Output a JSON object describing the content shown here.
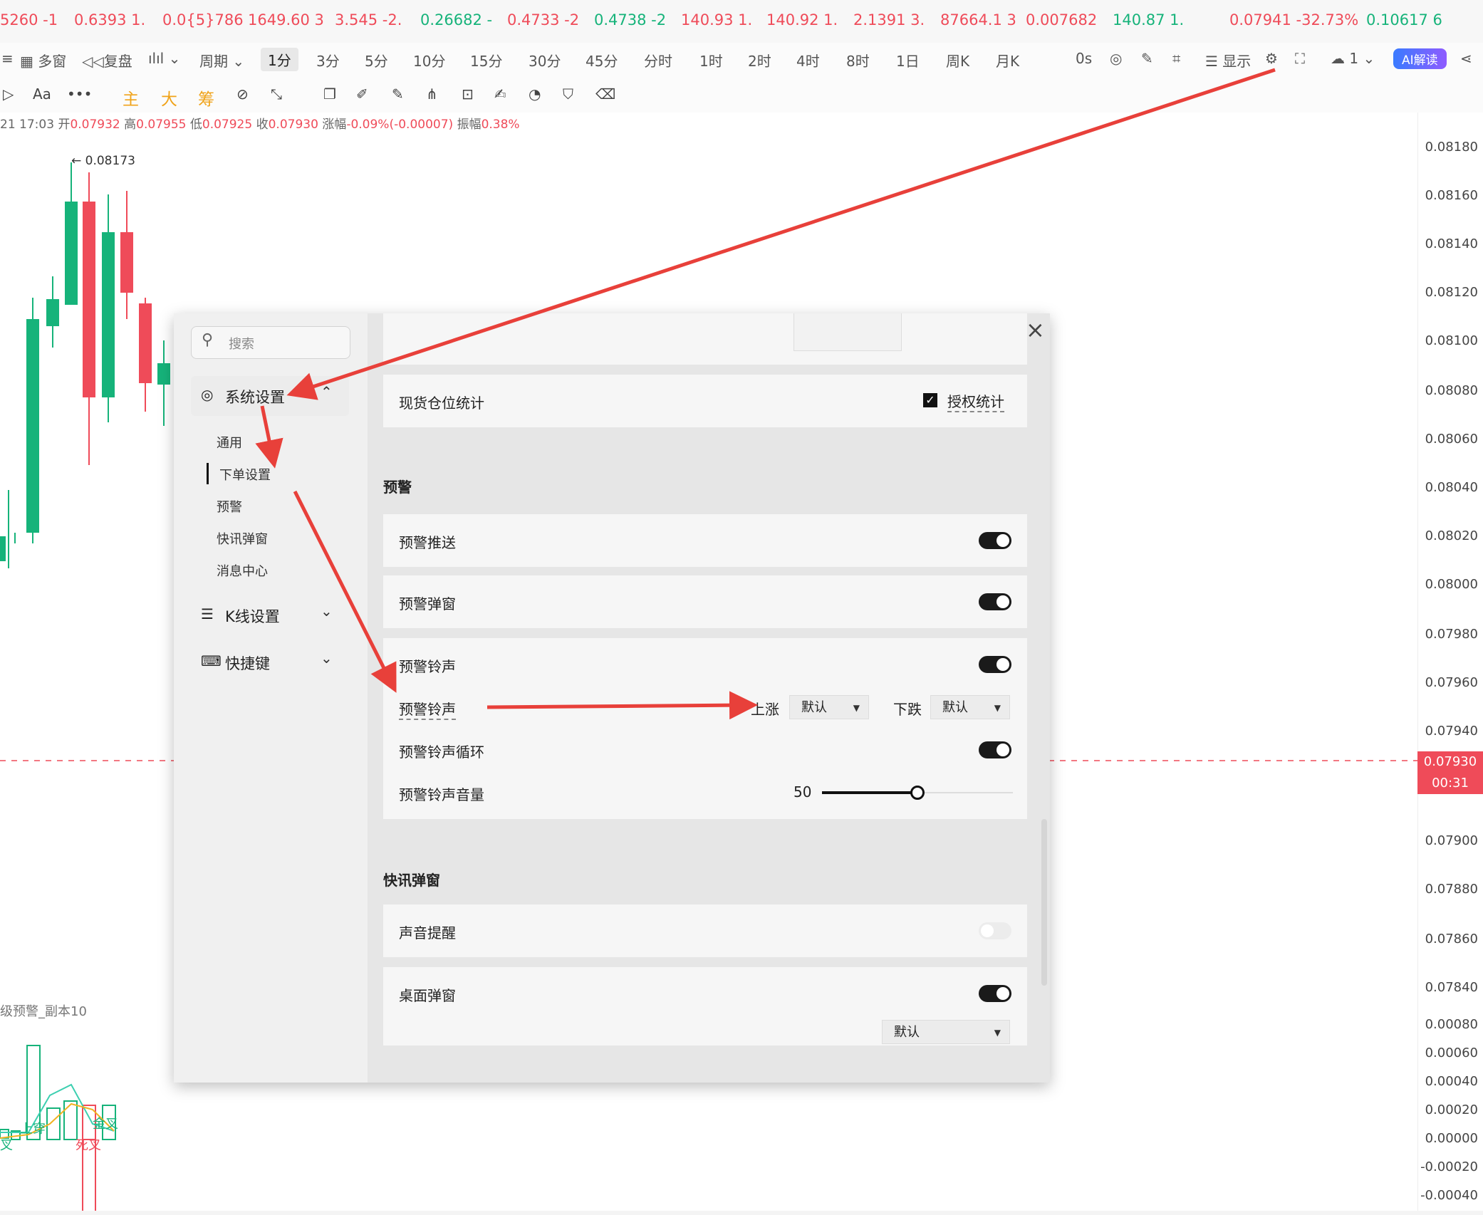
{
  "ticker": [
    {
      "text": "5260 -1",
      "cls": "dn"
    },
    {
      "text": "0.6393 1.",
      "cls": "dn"
    },
    {
      "text": "0.0{5}786",
      "cls": "dn"
    },
    {
      "text": "1649.60 3",
      "cls": "dn"
    },
    {
      "text": "3.545 -2.",
      "cls": "dn"
    },
    {
      "text": "0.26682 -",
      "cls": "up"
    },
    {
      "text": "0.4733 -2",
      "cls": "dn"
    },
    {
      "text": "0.4738 -2",
      "cls": "up"
    },
    {
      "text": "140.93 1.",
      "cls": "dn"
    },
    {
      "text": "140.92 1.",
      "cls": "dn"
    },
    {
      "text": "2.1391 3.",
      "cls": "dn"
    },
    {
      "text": "87664.1 3",
      "cls": "dn"
    },
    {
      "text": "0.007682",
      "cls": "dn"
    },
    {
      "text": "140.87 1.",
      "cls": "up"
    },
    {
      "text": "0.07941 -32.73%",
      "cls": "dn"
    },
    {
      "text": "0.10617 6",
      "cls": "up"
    }
  ],
  "toolbar": {
    "multiwin": "多窗",
    "replay": "复盘",
    "period": "周期",
    "periods": [
      "1分",
      "3分",
      "5分",
      "10分",
      "15分",
      "30分",
      "45分",
      "分时",
      "1时",
      "2时",
      "4时",
      "8时",
      "1日",
      "周K",
      "月K"
    ],
    "countdown": "0s",
    "display": "显示",
    "cloud": "1",
    "ai": "AI解读"
  },
  "toolbar2": {
    "font": "Aa",
    "more": "•••",
    "zhu": "主",
    "da": "大",
    "chou": "筹"
  },
  "ohlc": {
    "time": "21 17:03",
    "open_l": "开",
    "open": "0.07932",
    "high_l": "高",
    "high": "0.07955",
    "low_l": "低",
    "low": "0.07925",
    "close_l": "收",
    "close": "0.07930",
    "chg_l": "涨幅",
    "chg": "-0.09%(-0.00007)",
    "amp_l": "振幅",
    "amp": "0.38%"
  },
  "chart": {
    "high_label": "← 0.08173",
    "indicator_label": "级预警_副本10",
    "tags": [
      "上穿",
      "死叉",
      "金叉",
      "叉"
    ],
    "price_tag": "0.07930",
    "time_tag": "00:31"
  },
  "axis": [
    "0.08180",
    "0.08160",
    "0.08140",
    "0.08120",
    "0.08100",
    "0.08080",
    "0.08060",
    "0.08040",
    "0.08020",
    "0.08000",
    "0.07980",
    "0.07960",
    "0.07940",
    "0.07900",
    "0.07880",
    "0.07860",
    "0.07840",
    "0.00080",
    "0.00060",
    "0.00040",
    "0.00020",
    "0.00000",
    "-0.00020",
    "-0.00040"
  ],
  "dialog": {
    "search_placeholder": "搜索",
    "sys_settings": "系统设置",
    "sub_items": [
      "通用",
      "下单设置",
      "预警",
      "快讯弹窗",
      "消息中心"
    ],
    "kline_settings": "K线设置",
    "shortcuts": "快捷键",
    "close": "×",
    "spot_stats": "现货仓位统计",
    "auth_stats": "授权统计",
    "alert_section": "预警",
    "alert_push": "预警推送",
    "alert_popup": "预警弹窗",
    "alert_sound": "预警铃声",
    "alert_sound2": "预警铃声",
    "rise": "上涨",
    "rise_val": "默认",
    "fall": "下跌",
    "fall_val": "默认",
    "alert_loop": "预警铃声循环",
    "alert_volume": "预警铃声音量",
    "volume": "50",
    "news_section": "快讯弹窗",
    "sound_remind": "声音提醒",
    "desktop_popup": "桌面弹窗",
    "desktop_val": "默认"
  }
}
